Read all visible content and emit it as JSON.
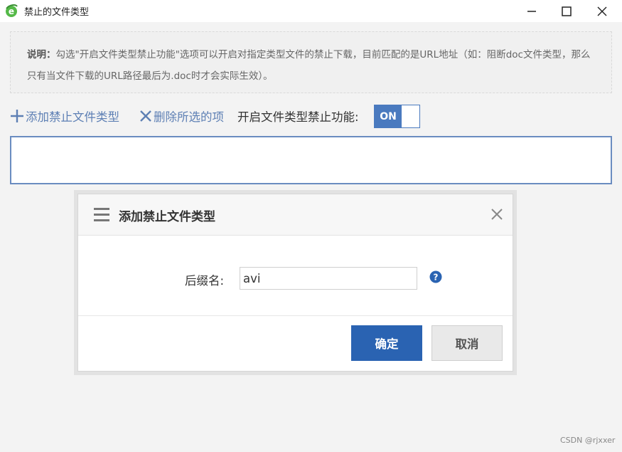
{
  "window": {
    "title": "禁止的文件类型",
    "icon": "ie-browser-icon"
  },
  "notice": {
    "label": "说明：",
    "text": "勾选\"开启文件类型禁止功能\"选项可以开启对指定类型文件的禁止下载，目前匹配的是URL地址（如：阻断doc文件类型，那么只有当文件下载的URL路径最后为.doc时才会实际生效）。"
  },
  "toolbar": {
    "add_label": "添加禁止文件类型",
    "delete_label": "删除所选的项",
    "toggle_label": "开启文件类型禁止功能:",
    "toggle_state": "ON"
  },
  "list": {
    "items": []
  },
  "dialog": {
    "title": "添加禁止文件类型",
    "suffix_label": "后缀名:",
    "suffix_value": "avi",
    "ok_label": "确定",
    "cancel_label": "取消"
  },
  "colors": {
    "accent": "#2a63b2",
    "link": "#5d7fb4",
    "toggle": "#4a7abf",
    "help_icon": "#2a63b2"
  },
  "watermark": "CSDN @rjxxer"
}
